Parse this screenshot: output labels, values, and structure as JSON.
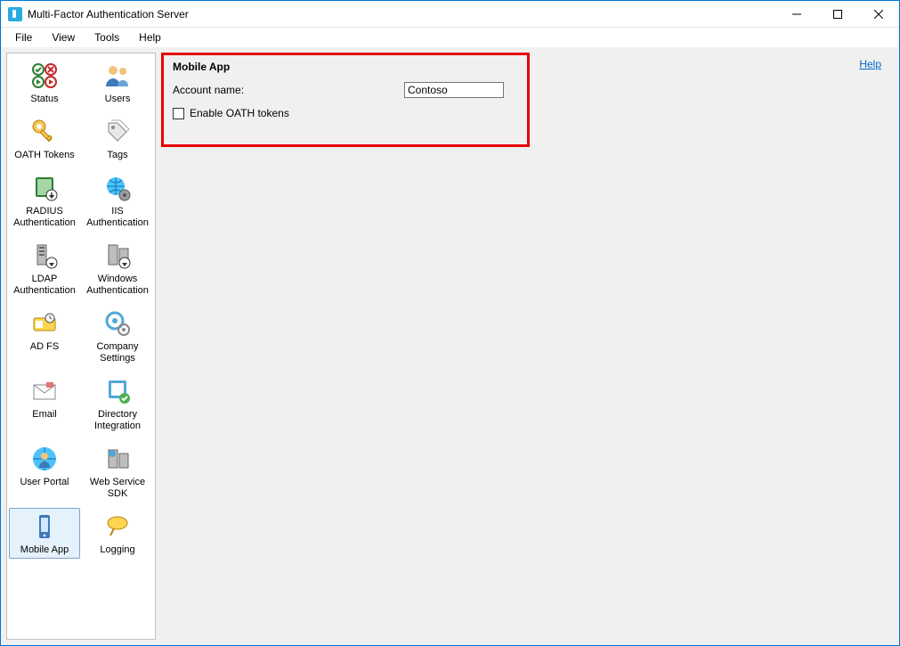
{
  "window": {
    "title": "Multi-Factor Authentication Server"
  },
  "menu": {
    "file": "File",
    "view": "View",
    "tools": "Tools",
    "help": "Help"
  },
  "nav": {
    "items": [
      {
        "label": "Status",
        "label2": ""
      },
      {
        "label": "Users",
        "label2": ""
      },
      {
        "label": "OATH Tokens",
        "label2": ""
      },
      {
        "label": "Tags",
        "label2": ""
      },
      {
        "label": "RADIUS",
        "label2": "Authentication"
      },
      {
        "label": "IIS",
        "label2": "Authentication"
      },
      {
        "label": "LDAP",
        "label2": "Authentication"
      },
      {
        "label": "Windows",
        "label2": "Authentication"
      },
      {
        "label": "AD FS",
        "label2": ""
      },
      {
        "label": "Company",
        "label2": "Settings"
      },
      {
        "label": "Email",
        "label2": ""
      },
      {
        "label": "Directory",
        "label2": "Integration"
      },
      {
        "label": "User Portal",
        "label2": ""
      },
      {
        "label": "Web Service",
        "label2": "SDK"
      },
      {
        "label": "Mobile App",
        "label2": ""
      },
      {
        "label": "Logging",
        "label2": ""
      }
    ]
  },
  "content": {
    "help": "Help",
    "title": "Mobile App",
    "account_label": "Account name:",
    "account_value": "Contoso",
    "oath_label": "Enable OATH tokens"
  }
}
